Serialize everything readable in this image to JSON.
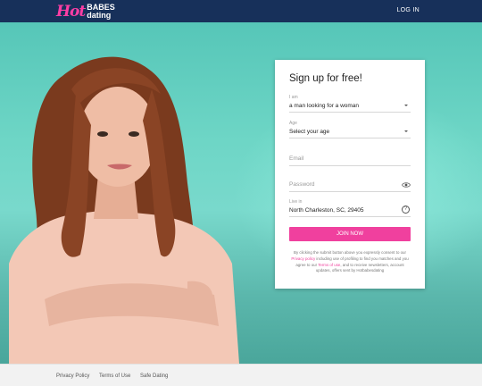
{
  "header": {
    "logo_script": "Hot",
    "logo_top": "BABES",
    "logo_bottom": "dating",
    "login_label": "LOG IN"
  },
  "form": {
    "title": "Sign up for free!",
    "i_am": {
      "label": "I am",
      "value": "a man looking for a woman"
    },
    "age": {
      "label": "Age",
      "value": "Select your age"
    },
    "email": {
      "placeholder": "Email"
    },
    "password": {
      "placeholder": "Password"
    },
    "location": {
      "label": "Live in",
      "value": "North Charleston, SC, 29405"
    },
    "join_label": "JOIN NOW",
    "legal": {
      "part1": "By clicking the submit button above you expressly consent to our ",
      "privacy_link": "Privacy policy",
      "part2": " including use of profiling to find you matches and you agree to our ",
      "terms_link": "Terms of use",
      "part3": ", and to receive newsletters, account updates, offers sent by Hotbabesdating"
    }
  },
  "footer": {
    "links": [
      "Privacy Policy",
      "Terms of Use",
      "Safe Dating"
    ]
  },
  "colors": {
    "header_bg": "#17305a",
    "accent_pink": "#f0409e",
    "hero_teal": "#6ed6c6"
  }
}
